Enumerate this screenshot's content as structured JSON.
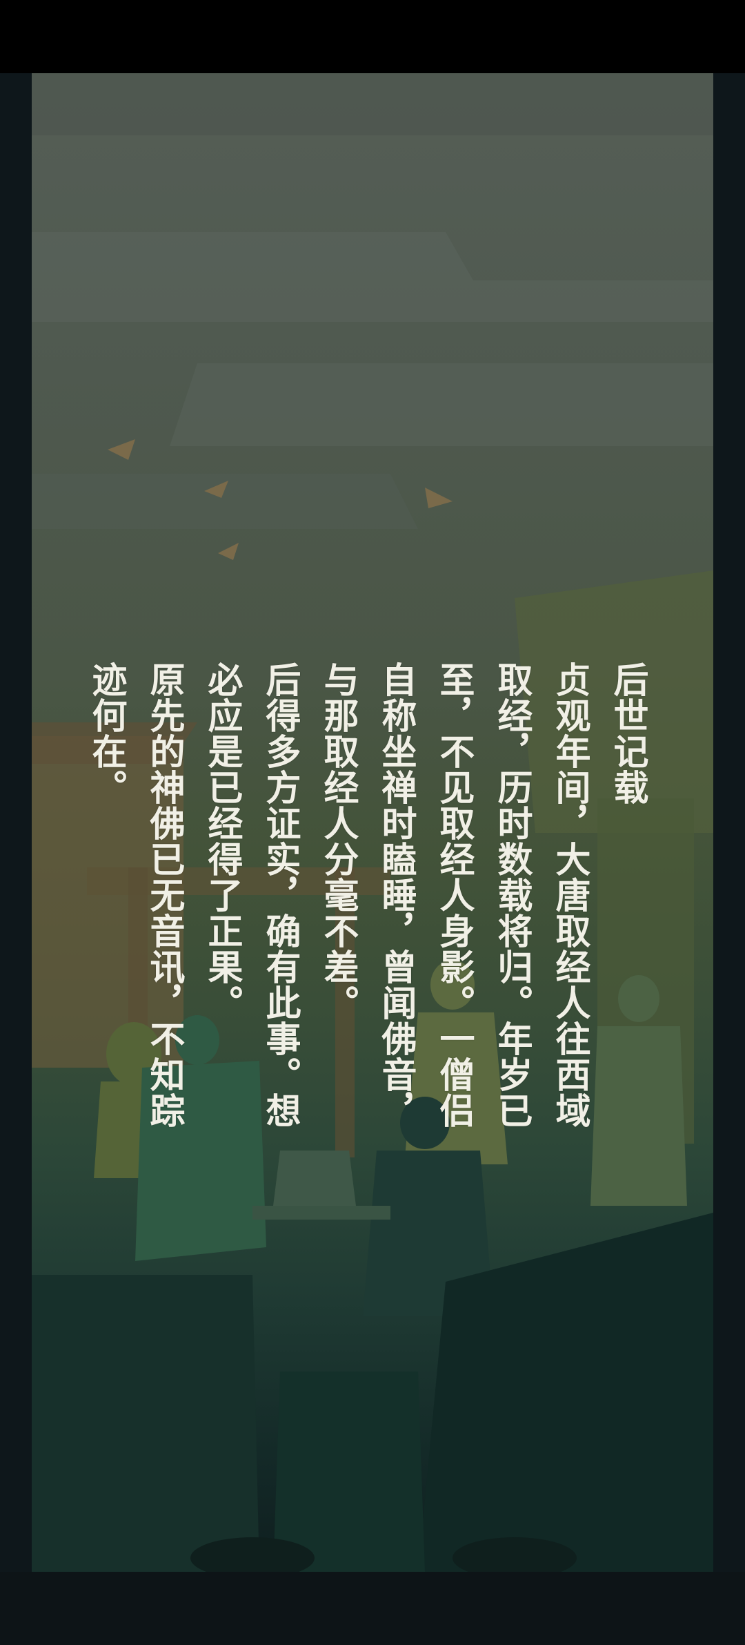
{
  "story": {
    "lines": [
      "后世记载",
      "贞观年间，大唐取经人往西域",
      "取经，历时数载将归。年岁已",
      "至，不见取经人身影。一僧侣",
      "自称坐禅时瞌睡，曾闻佛音，",
      "与那取经人分毫不差。",
      "后得多方证实，确有此事。想",
      "必应是已经得了正果。",
      "原先的神佛已无音讯，不知踪",
      "迹何在。"
    ]
  },
  "colors": {
    "text": "#f1f0e6",
    "sky": "#555e56",
    "ground": "#0f1e1f"
  }
}
